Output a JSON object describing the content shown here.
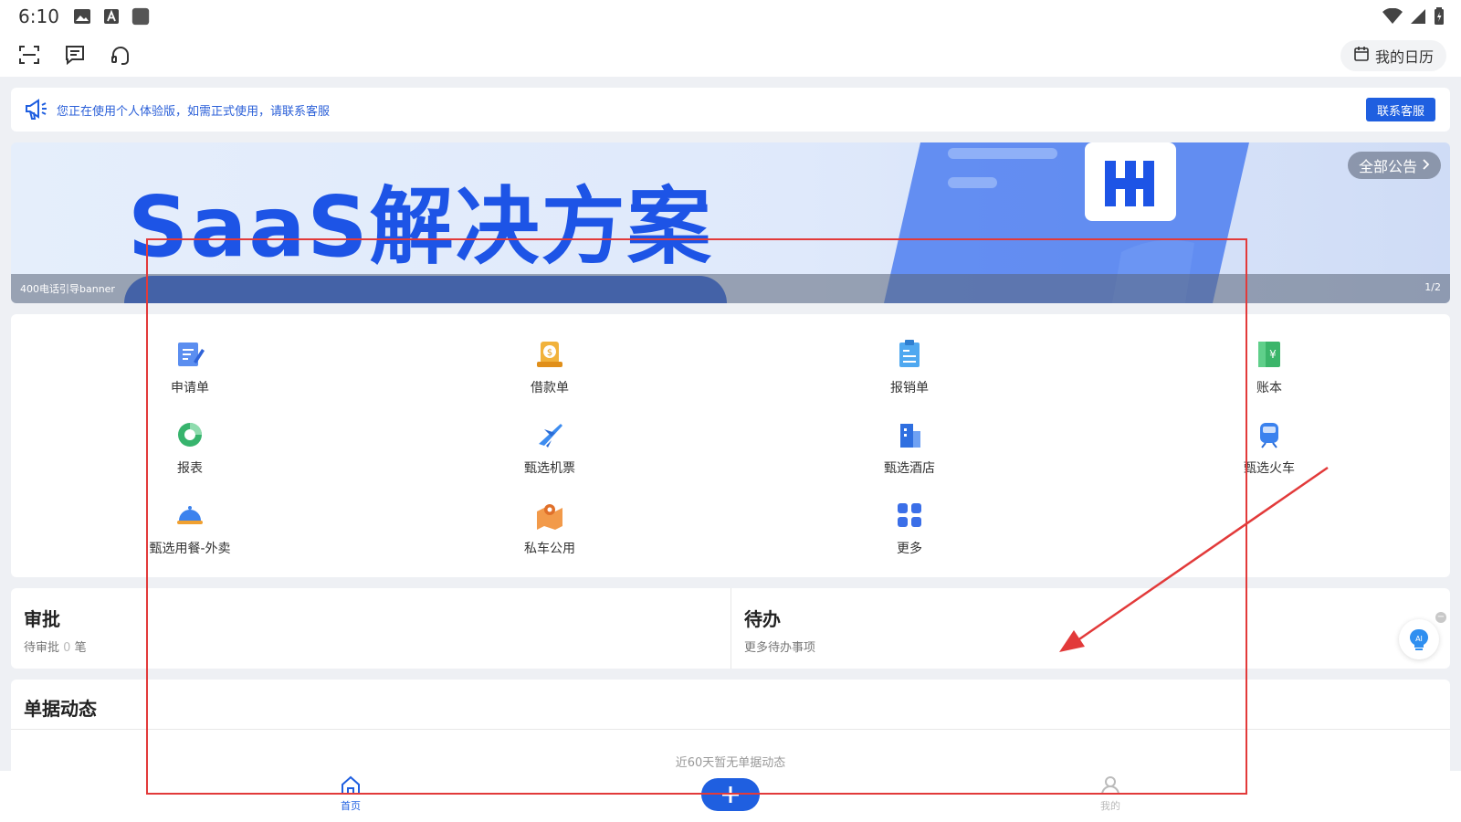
{
  "status_bar": {
    "time": "6:10"
  },
  "toolbar": {
    "calendar_label": "我的日历"
  },
  "notice": {
    "text": "您正在使用个人体验版，如需正式使用，请联系客服",
    "contact_label": "联系客服"
  },
  "banner": {
    "headline": "SaaS解决方案",
    "caption": "400电话引导banner",
    "index": "1/2",
    "all_notices_label": "全部公告"
  },
  "quick_actions": [
    {
      "label": "申请单",
      "icon": "form-edit-icon"
    },
    {
      "label": "借款单",
      "icon": "loan-icon"
    },
    {
      "label": "报销单",
      "icon": "reimburse-icon"
    },
    {
      "label": "账本",
      "icon": "ledger-icon"
    },
    {
      "label": "报表",
      "icon": "report-icon"
    },
    {
      "label": "甄选机票",
      "icon": "plane-icon"
    },
    {
      "label": "甄选酒店",
      "icon": "hotel-icon"
    },
    {
      "label": "甄选火车",
      "icon": "train-icon"
    },
    {
      "label": "甄选用餐-外卖",
      "icon": "meal-icon"
    },
    {
      "label": "私车公用",
      "icon": "car-map-icon"
    },
    {
      "label": "更多",
      "icon": "grid-more-icon"
    }
  ],
  "approval": {
    "title": "审批",
    "sub_prefix": "待审批",
    "count": "0",
    "sub_suffix": "笔"
  },
  "todo": {
    "title": "待办",
    "sub": "更多待办事项"
  },
  "feed": {
    "title": "单据动态",
    "empty_text": "近60天暂无单据动态"
  },
  "bottom_nav": {
    "home_label": "首页",
    "mine_label": "我的"
  },
  "colors": {
    "accent": "#1f5fe0",
    "annotation": "#e23a3a"
  }
}
